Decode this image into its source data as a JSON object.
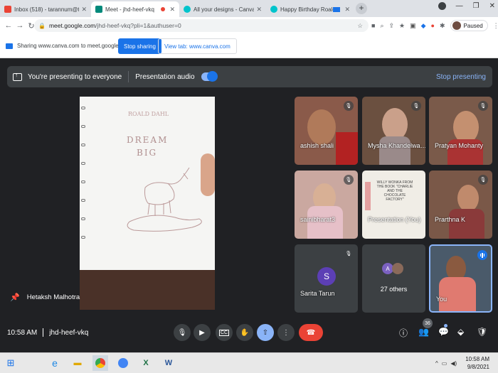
{
  "browser": {
    "tabs": [
      {
        "title": "Inbox (518) - tarannum@theindi…",
        "active": false,
        "icon_color": "#ea4335",
        "icon": "gmail-icon"
      },
      {
        "title": "Meet - jhd-heef-vkq",
        "active": true,
        "icon_color": "#00897b",
        "icon": "meet-icon"
      },
      {
        "title": "All your designs - Canva",
        "active": false,
        "icon_color": "#00c4cc",
        "icon": "canva-icon"
      },
      {
        "title": "Happy Birthday Roald Dahl",
        "active": false,
        "icon_color": "#00c4cc",
        "icon": "canva-icon"
      }
    ],
    "url_host": "meet.google.com",
    "url_rest": "/jhd-heef-vkq?pli=1&authuser=0",
    "profile_status": "Paused"
  },
  "sharebar": {
    "text": "Sharing www.canva.com to meet.google.com",
    "stop_label": "Stop sharing",
    "view_label": "View tab: www.canva.com"
  },
  "presenting": {
    "text": "You're presenting to everyone",
    "audio_label": "Presentation audio",
    "audio_on": true,
    "stop_label": "Stop presenting"
  },
  "main_video": {
    "presenter": "Hetaksh Malhotra",
    "drawing_text": [
      "ROALD DAHL",
      "DREAM",
      "BIG"
    ]
  },
  "participants": [
    {
      "name": "ashish shali",
      "muted": true
    },
    {
      "name": "Mysha Khandelwa…",
      "muted": true
    },
    {
      "name": "Pratyan Mohanty",
      "muted": true
    },
    {
      "name": "sainibharat3",
      "muted": true
    },
    {
      "name": "Presentation (You)",
      "muted": false,
      "slide_text": "WILLY WONKA FROM THE BOOK \"CHARLIE AND THE CHOCOLATE FACTORY\""
    },
    {
      "name": "Prarthna K",
      "muted": true
    },
    {
      "name": "Sarita Tarun",
      "muted": true,
      "initial": "S"
    },
    {
      "name": "27 others",
      "muted": false
    },
    {
      "name": "You",
      "muted": false,
      "speaking": true
    }
  ],
  "others_initials": [
    "A"
  ],
  "meeting": {
    "time": "10:58 AM",
    "code": "jhd-heef-vkq",
    "people_count": "36"
  },
  "taskbar": {
    "time": "10:58 AM",
    "date": "9/8/2021"
  }
}
